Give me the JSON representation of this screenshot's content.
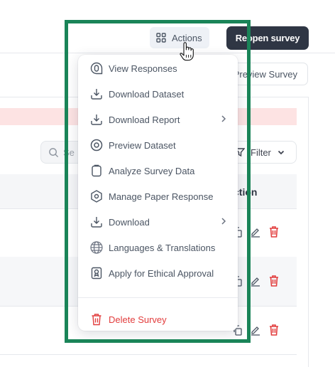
{
  "header": {
    "actions_label": "Actions",
    "reopen_label": "Reopen survey"
  },
  "toolbar": {
    "preview_label": "Preview Survey",
    "search_placeholder": "Se",
    "filter_label": "Filter"
  },
  "table": {
    "action_header": "ction"
  },
  "menu": {
    "items": [
      {
        "label": "View Responses",
        "icon": "view-responses-icon"
      },
      {
        "label": "Download Dataset",
        "icon": "download-icon"
      },
      {
        "label": "Download Report",
        "icon": "download-icon",
        "submenu": true
      },
      {
        "label": "Preview Dataset",
        "icon": "eye-icon"
      },
      {
        "label": "Analyze Survey Data",
        "icon": "clipboard-icon"
      },
      {
        "label": "Manage Paper Response",
        "icon": "hexagon-icon"
      },
      {
        "label": "Download",
        "icon": "download-icon",
        "submenu": true
      },
      {
        "label": "Languages & Translations",
        "icon": "globe-icon"
      },
      {
        "label": "Apply for Ethical Approval",
        "icon": "approval-icon"
      }
    ],
    "delete_label": "Delete Survey"
  },
  "colors": {
    "highlight": "#1a8458",
    "danger": "#e23d3d",
    "primary_dark": "#2f3644"
  }
}
